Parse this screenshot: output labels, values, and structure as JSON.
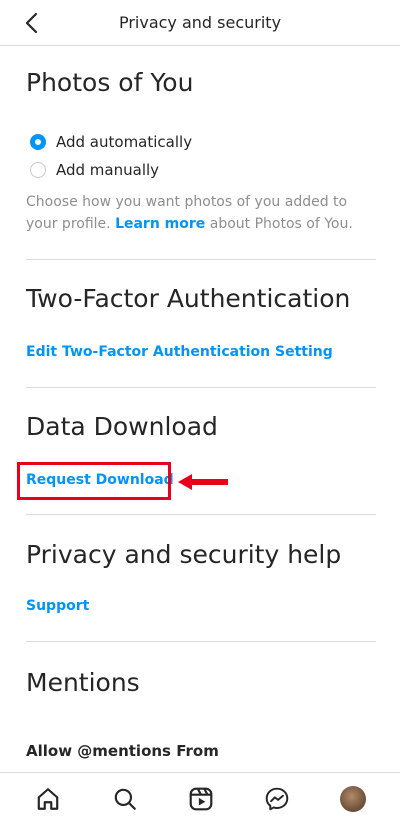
{
  "header": {
    "title": "Privacy and security",
    "back_icon": "chevron-left-icon"
  },
  "photos_of_you": {
    "title": "Photos of You",
    "options": [
      {
        "label": "Add automatically",
        "selected": true
      },
      {
        "label": "Add manually",
        "selected": false
      }
    ],
    "helper_before": "Choose how you want photos of you added to your profile.",
    "helper_link": "Learn more",
    "helper_after": "about Photos of You."
  },
  "two_factor": {
    "title": "Two-Factor Authentication",
    "link": "Edit Two-Factor Authentication Setting"
  },
  "data_download": {
    "title": "Data Download",
    "link": "Request Download"
  },
  "help": {
    "title": "Privacy and security help",
    "link": "Support"
  },
  "mentions": {
    "title": "Mentions",
    "subheading": "Allow @mentions From"
  },
  "bottom_nav": {
    "items": [
      "home-icon",
      "search-icon",
      "reels-icon",
      "messenger-icon",
      "profile-avatar"
    ]
  },
  "colors": {
    "accent": "#0095f6",
    "highlight": "#e8001c",
    "text": "#262626",
    "muted": "#8e8e8e"
  }
}
